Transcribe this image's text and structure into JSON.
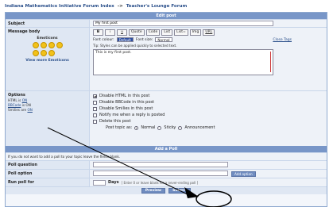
{
  "breadcrumb": {
    "forum": "Indiana Mathematics Initiative Forum Index",
    "separator": "->",
    "section": "Teacher's Lounge Forum"
  },
  "edit_post": {
    "header": "Edit post",
    "subject_label": "Subject",
    "subject_value": "My first post",
    "message_label": "Message body",
    "emoticons_label": "Emoticons",
    "view_more": "View more Emoticons",
    "format_buttons": [
      "B",
      "i",
      "u",
      "Quote",
      "Code",
      "List",
      "List=",
      "Img",
      "URL"
    ],
    "font_colour_label": "Font colour:",
    "font_colour_value": "Default",
    "font_size_label": "Font size:",
    "font_size_value": "Normal",
    "close_tags": "Close Tags",
    "tip": "Tip: Styles can be applied quickly to selected text.",
    "message_text": "This is my first post."
  },
  "options": {
    "label": "Options",
    "html_status_label": "HTML is",
    "html_status": "ON",
    "bbcode_label": "BBCode",
    "bbcode_status": "is ON",
    "smilies_label": "Smilies are",
    "smilies_status": "ON",
    "items": [
      {
        "label": "Disable HTML in this post",
        "checked": true
      },
      {
        "label": "Disable BBCode in this post",
        "checked": false
      },
      {
        "label": "Disable Smilies in this post",
        "checked": false
      },
      {
        "label": "Notify me when a reply is posted",
        "checked": false
      },
      {
        "label": "Delete this post",
        "checked": false
      }
    ],
    "post_topic_label": "Post topic as:",
    "topic_types": [
      {
        "label": "Normal",
        "selected": true
      },
      {
        "label": "Sticky",
        "selected": false
      },
      {
        "label": "Announcement",
        "selected": false
      }
    ]
  },
  "poll": {
    "header": "Add a Poll",
    "note": "If you do not want to add a poll to your topic leave the fields blank.",
    "question_label": "Poll question",
    "option_label": "Poll option",
    "add_option_button": "Add option",
    "run_for_label": "Run poll for",
    "days_label": "Days",
    "days_hint": "[ Enter 0 or leave blank for a never-ending poll ]"
  },
  "actions": {
    "preview": "Preview",
    "submit": "Submit"
  }
}
